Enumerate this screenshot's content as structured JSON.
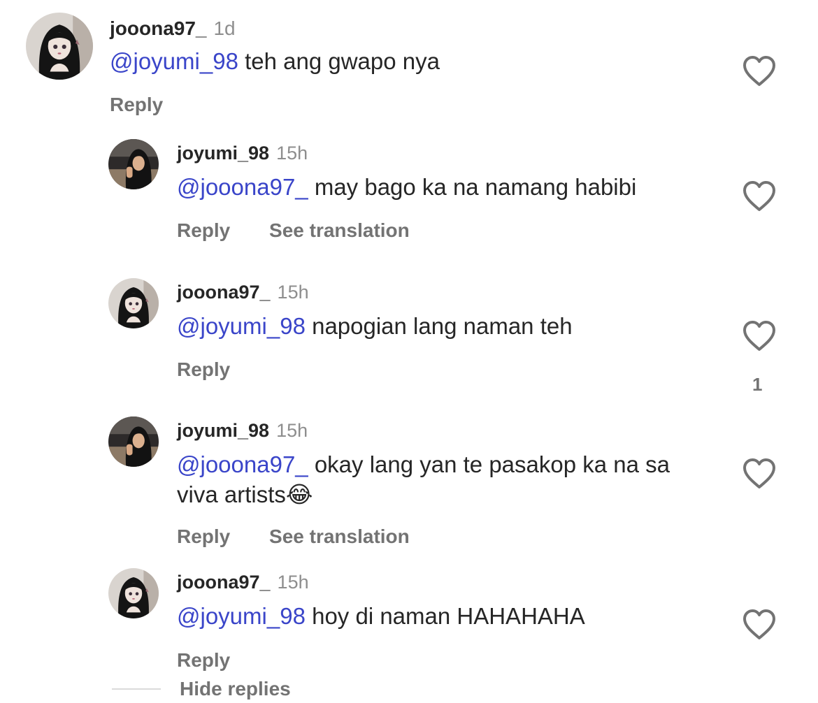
{
  "comments": [
    {
      "username": "jooona97_",
      "time": "1d",
      "mention": "@joyumi_98",
      "text": " teh ang gwapo nya",
      "reply_label": "Reply",
      "avatar_icon": "anime-girl-avatar"
    },
    {
      "username": "joyumi_98",
      "time": "15h",
      "mention": "@jooona97_",
      "text": " may bago ka na namang habibi",
      "reply_label": "Reply",
      "translation_label": "See translation",
      "avatar_icon": "user-photo-avatar"
    },
    {
      "username": "jooona97_",
      "time": "15h",
      "mention": "@joyumi_98",
      "text": " napogian lang naman teh",
      "reply_label": "Reply",
      "like_count": "1",
      "avatar_icon": "anime-girl-avatar"
    },
    {
      "username": "joyumi_98",
      "time": "15h",
      "mention": "@jooona97_",
      "text": " okay lang yan te pasakop ka na sa viva artists",
      "emoji": "😂",
      "reply_label": "Reply",
      "translation_label": "See translation",
      "avatar_icon": "user-photo-avatar"
    },
    {
      "username": "jooona97_",
      "time": "15h",
      "mention": "@joyumi_98",
      "text": " hoy di naman HAHAHAHA",
      "reply_label": "Reply",
      "avatar_icon": "anime-girl-avatar"
    }
  ],
  "hide_replies_label": "Hide replies",
  "colors": {
    "mention": "#3a45c9",
    "secondary_text": "#737373",
    "primary_text": "#262626"
  }
}
